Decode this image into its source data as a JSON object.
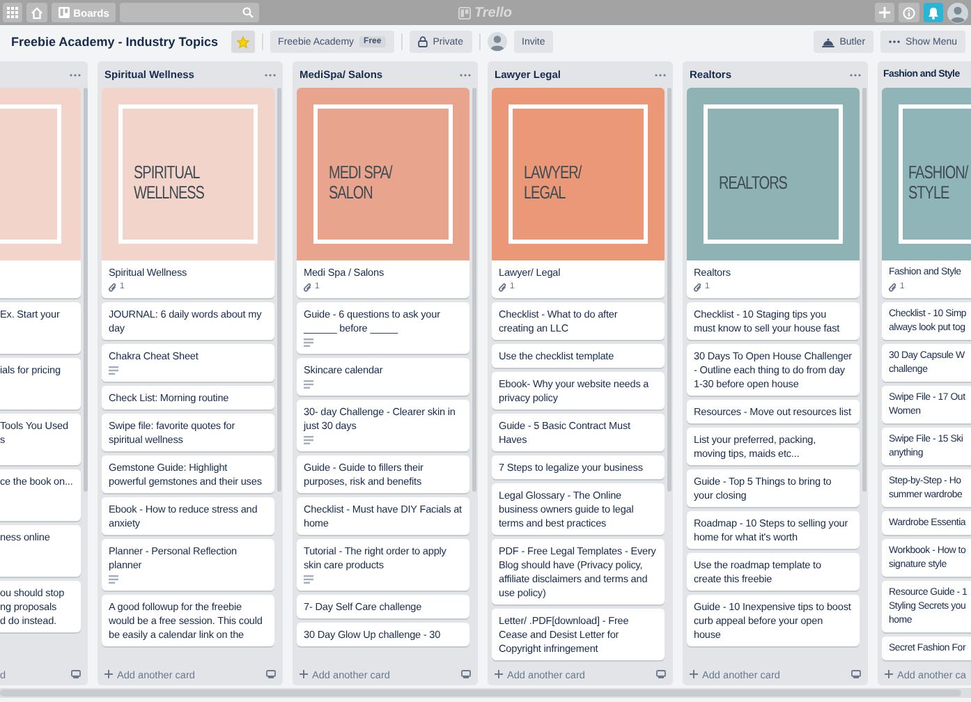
{
  "top_bar": {
    "boards": "Boards",
    "logo": "Trello"
  },
  "board": {
    "title": "Freebie Academy - Industry Topics",
    "starred": true,
    "team": "Freebie Academy",
    "plan": "Free",
    "visibility": "Private",
    "invite": "Invite",
    "butler": "Butler",
    "menu": "Show Menu"
  },
  "lists": [
    {
      "kind": "cut-left",
      "footer": "d",
      "cards": [
        {
          "cover": {
            "color": "#f3d4ca"
          }
        },
        {
          "title": "Ex. Start your"
        },
        {
          "title": "ials for pricing"
        },
        {
          "title": "Tools You Used\ns"
        },
        {
          "title": "ce the book on..."
        },
        {
          "title": "ness online"
        },
        {
          "title": "ou should stop\nng proposals\nd do instead."
        }
      ]
    },
    {
      "kind": "full",
      "title": "Spiritual Wellness",
      "footer": "Add another card",
      "cards": [
        {
          "cover": {
            "color": "#f3d4ca",
            "heading": "SPIRITUAL\nWELLNESS"
          },
          "title": "Spiritual Wellness",
          "attachments": "1"
        },
        {
          "title": "JOURNAL: 6 daily words about my\nday"
        },
        {
          "title": "Chakra Cheat Sheet",
          "description": true
        },
        {
          "title": "Check List: Morning routine"
        },
        {
          "title": "Swipe file: favorite quotes for\nspiritual wellness"
        },
        {
          "title": "Gemstone Guide: Highlight\npowerful gemstones and their uses"
        },
        {
          "title": "Ebook - How to reduce stress and\nanxiety"
        },
        {
          "title": "Planner - Personal Reflection\nplanner",
          "description": true
        },
        {
          "title": "A good followup for the freebie\nwould be a free session. This could\nbe easily a calendar link on the"
        }
      ]
    },
    {
      "kind": "full",
      "title": "MediSpa/ Salons",
      "footer": "Add another card",
      "cards": [
        {
          "cover": {
            "color": "#e8a48d",
            "heading": "MEDI SPA/\nSALON"
          },
          "title": "Medi Spa / Salons",
          "attachments": "1"
        },
        {
          "title": "Guide - 6 questions to ask your\n______ before _____",
          "description": true
        },
        {
          "title": "Skincare calendar",
          "description": true
        },
        {
          "title": "30- day Challenge - Clearer skin in\njust 30 days",
          "description": true
        },
        {
          "title": "Guide - Guide to fillers their\npurposes, risk and benefits"
        },
        {
          "title": "Checklist - Must have DIY Facials at\nhome"
        },
        {
          "title": "Tutorial - The right order to apply\nskin care products",
          "description": true
        },
        {
          "title": "7- Day Self Care challenge"
        },
        {
          "title": "30 Day Glow Up challenge - 30"
        }
      ]
    },
    {
      "kind": "full",
      "title": "Lawyer Legal",
      "footer": "Add another card",
      "cards": [
        {
          "cover": {
            "color": "#ea9878",
            "heading": "LAWYER/\nLEGAL"
          },
          "title": "Lawyer/ Legal",
          "attachments": "1"
        },
        {
          "title": "Checklist - What to do after\ncreating an LLC"
        },
        {
          "title": "Use the checklist template"
        },
        {
          "title": "Ebook- Why your website needs a\nprivacy policy"
        },
        {
          "title": "Guide - 5 Basic Contract Must\nHaves"
        },
        {
          "title": "7 Steps to legalize your business"
        },
        {
          "title": "Legal Glossary - The Online\nbusiness owners guide to legal\nterms and best practices"
        },
        {
          "title": "PDF - Free Legal Templates - Every\nBlog should have (Privacy policy,\naffiliate disclaimers and terms and\nuse policy)"
        },
        {
          "title": "Letter/ .PDF[download] - Free\nCease and Desist Letter for\nCopyright infringement"
        }
      ]
    },
    {
      "kind": "full",
      "title": "Realtors",
      "footer": "Add another card",
      "cards": [
        {
          "cover": {
            "color": "#8fb2b5",
            "heading": "REALTORS"
          },
          "title": "Realtors",
          "attachments": "1"
        },
        {
          "title": "Checklist - 10 Staging tips you\nmust know to sell your house fast"
        },
        {
          "title": "30 Days To Open House Challenger\n- Outline each thing to do from day\n1-30 before open house"
        },
        {
          "title": "Resources - Move out resources list"
        },
        {
          "title": "List your preferred, packing,\nmoving tips, maids etc..."
        },
        {
          "title": "Guide - Top 5 Things to bring to\nyour closing"
        },
        {
          "title": "Roadmap - 10 Steps to selling your\nhome for what it's worth"
        },
        {
          "title": "Use the roadmap template to\ncreate this freebie"
        },
        {
          "title": "Guide - 10 Inexpensive tips to boost\ncurb appeal before your open\nhouse"
        }
      ]
    },
    {
      "kind": "cut-right",
      "title": "Fashion and Style",
      "footer": "Add another ca",
      "cards": [
        {
          "cover": {
            "color": "#8fb5b8",
            "heading": "FASHION/\nSTYLE"
          },
          "title": "Fashion and Style",
          "attachments": "1"
        },
        {
          "title": "Checklist - 10 Simp\nalways look put tog"
        },
        {
          "title": "30 Day Capsule W\nchallenge"
        },
        {
          "title": "Swipe File - 17 Out\nWomen"
        },
        {
          "title": "Swipe File - 15 Ski\nanything"
        },
        {
          "title": "Step-by-Step - Ho\nsummer wardrobe"
        },
        {
          "title": "Wardrobe Essentia"
        },
        {
          "title": "Workbook - How to\nsignature style"
        },
        {
          "title": "Resource Guide - 1\nStyling Secrets you\nhome"
        },
        {
          "title": "Secret Fashion For"
        }
      ]
    }
  ]
}
